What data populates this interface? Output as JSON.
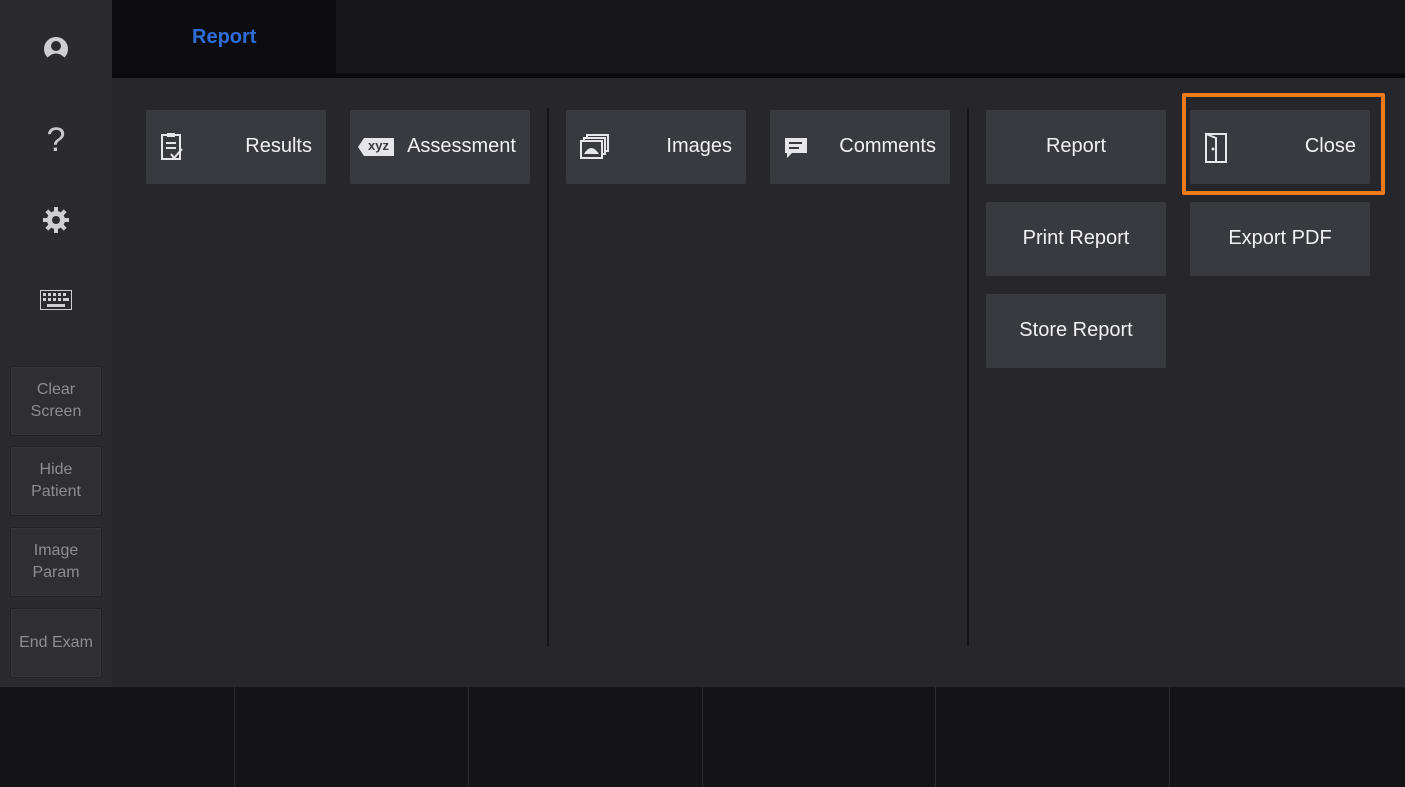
{
  "sidebar": {
    "icons": [
      {
        "name": "user-icon"
      },
      {
        "name": "help-icon",
        "glyph": "?"
      },
      {
        "name": "settings-gear-icon"
      },
      {
        "name": "keyboard-icon"
      }
    ],
    "buttons": [
      {
        "line1": "Clear",
        "line2": "Screen"
      },
      {
        "line1": "Hide",
        "line2": "Patient"
      },
      {
        "line1": "Image",
        "line2": "Param"
      },
      {
        "line1": "End Exam",
        "line2": ""
      }
    ]
  },
  "tabs": [
    {
      "label": "Report",
      "active": true
    }
  ],
  "colors": {
    "accent_tab": "#2f6ed8",
    "highlight_frame": "#f07a1a"
  },
  "toolbar": {
    "results": {
      "label": "Results",
      "icon": "clipboard-check-icon"
    },
    "assessment": {
      "label": "Assessment",
      "icon": "xyz-tag-icon",
      "icon_text": "xyz"
    },
    "images": {
      "label": "Images",
      "icon": "image-stack-icon"
    },
    "comments": {
      "label": "Comments",
      "icon": "comment-icon"
    },
    "report": {
      "label": "Report"
    },
    "close": {
      "label": "Close",
      "icon": "door-exit-icon",
      "highlighted": true
    },
    "print_report": {
      "label": "Print Report"
    },
    "export_pdf": {
      "label": "Export PDF"
    },
    "store_report": {
      "label": "Store Report"
    }
  }
}
